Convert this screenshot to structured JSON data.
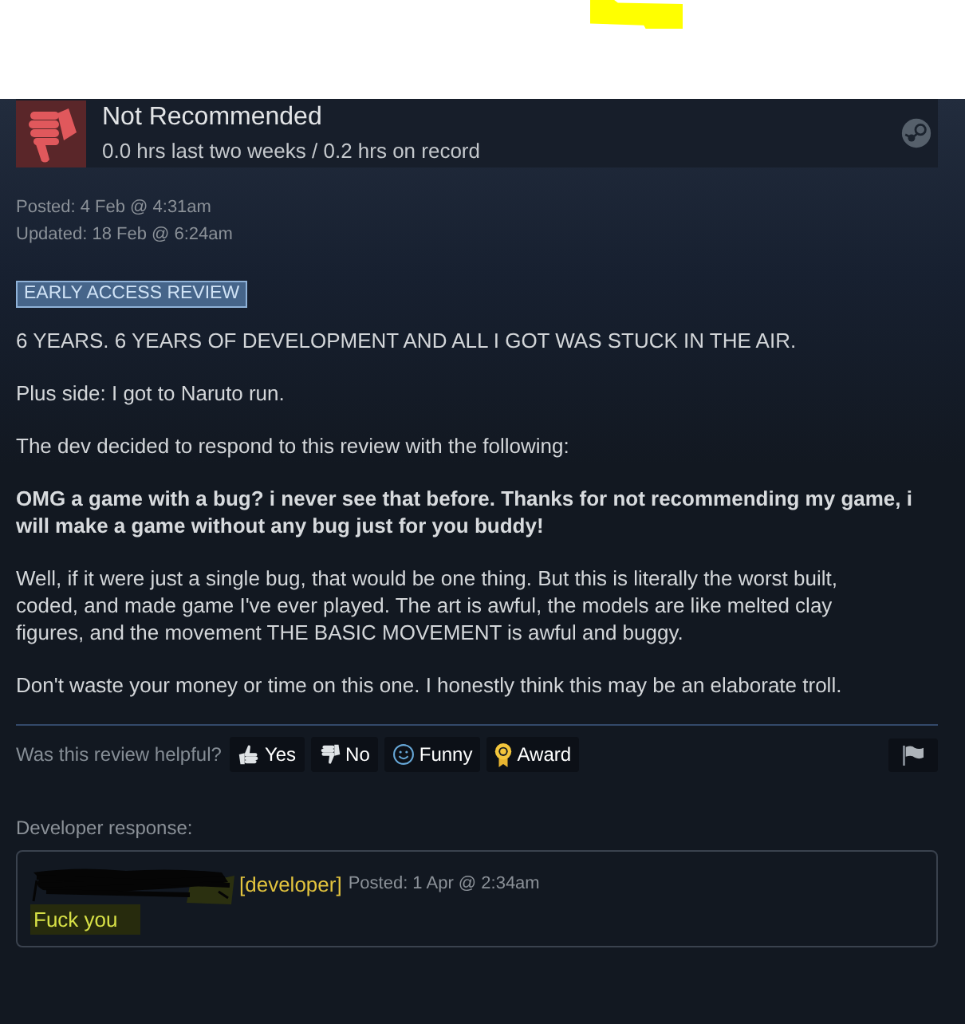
{
  "review": {
    "recommended": false,
    "verdict": "Not Recommended",
    "hours": "0.0 hrs last two weeks / 0.2 hrs on record"
  },
  "dates": [
    "Posted: 4 Feb @ 4:31am",
    "Updated: 18 Feb @ 6:24am"
  ],
  "badge": "EARLY ACCESS REVIEW",
  "paragraphs": [
    {
      "kind": "plain",
      "text": "6 YEARS. 6 YEARS OF DEVELOPMENT AND ALL I GOT WAS STUCK IN THE AIR."
    },
    {
      "kind": "plain",
      "text": "Plus side: I got to Naruto run."
    },
    {
      "kind": "plain",
      "text": "The dev decided to respond to this review with the following:"
    },
    {
      "kind": "bold",
      "text": "OMG a game with a bug? i never see that before. Thanks for not recommending my game, i will make a game without any bug just for you buddy!"
    },
    {
      "kind": "plain",
      "text": "Well, if it were just a single bug, that would be one thing. But this is literally the worst built, coded, and made game I've ever played. The art is awful, the models are like melted clay figures, and the movement THE BASIC MOVEMENT is awful and buggy."
    },
    {
      "kind": "plain",
      "text": "Don't waste your money or time on this one. I honestly think this may be an elaborate troll."
    }
  ],
  "helpful": {
    "prompt": "Was this review helpful?",
    "buttons": [
      {
        "kind": "yes",
        "label": "Yes"
      },
      {
        "kind": "no",
        "label": "No"
      },
      {
        "kind": "funny",
        "label": "Funny"
      },
      {
        "kind": "award",
        "label": "Award"
      },
      {
        "kind": "flag"
      }
    ]
  },
  "developer_response": {
    "heading": "Developer response:",
    "tag": "[developer]",
    "posted": "Posted: 1 Apr @ 2:34am",
    "text": "Fuck you"
  }
}
